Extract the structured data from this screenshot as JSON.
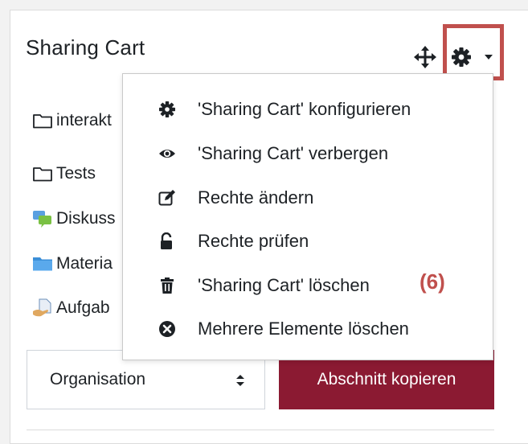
{
  "block": {
    "title": "Sharing Cart",
    "items": [
      {
        "icon": "folder-icon",
        "label": "interakt"
      },
      {
        "icon": "folder-icon",
        "label": "Tests"
      },
      {
        "icon": "forum-icon",
        "label": "Diskuss"
      },
      {
        "icon": "folder-blue-icon",
        "label": "Materia"
      },
      {
        "icon": "assignment-icon",
        "label": "Aufgab"
      }
    ]
  },
  "controls": {
    "move_icon": "move-icon",
    "gear_icon": "gear-icon",
    "caret_icon": "caret-down-icon"
  },
  "menu": {
    "items": [
      {
        "icon": "gear-icon",
        "label": "'Sharing Cart' konfigurieren"
      },
      {
        "icon": "eye-icon",
        "label": "'Sharing Cart' verbergen"
      },
      {
        "icon": "edit-icon",
        "label": "Rechte ändern"
      },
      {
        "icon": "unlock-icon",
        "label": "Rechte prüfen"
      },
      {
        "icon": "trash-icon",
        "label": "'Sharing Cart' löschen"
      },
      {
        "icon": "times-circle-icon",
        "label": "Mehrere Elemente löschen"
      }
    ]
  },
  "annotation": {
    "callout_label": "(6)",
    "highlight_color": "#c0504d"
  },
  "footer": {
    "select_value": "Organisation",
    "copy_button_label": "Abschnitt kopieren"
  },
  "colors": {
    "accent": "#8b1a32",
    "annotation": "#c0504d"
  }
}
